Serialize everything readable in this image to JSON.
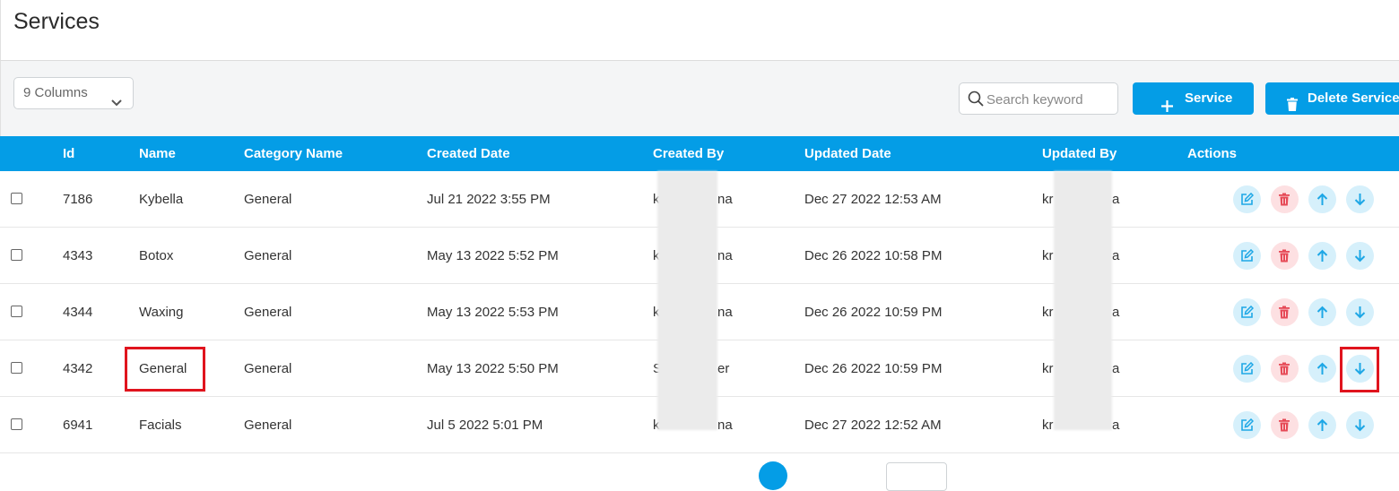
{
  "header": {
    "title": "Services"
  },
  "toolbar": {
    "columns_label": "9 Columns",
    "search_placeholder": "Search keyword",
    "add_label": "Service",
    "delete_label": "Delete Service"
  },
  "table": {
    "columns": [
      "Id",
      "Name",
      "Category Name",
      "Created Date",
      "Created By",
      "Updated Date",
      "Updated By",
      "Actions"
    ],
    "rows": [
      {
        "id": "7186",
        "name": "Kybella",
        "category": "General",
        "created_date": "Jul 21 2022 3:55 PM",
        "created_by_start": "k",
        "created_by_end": "na",
        "updated_date": "Dec 27 2022 12:53 AM",
        "updated_by_start": "kr",
        "updated_by_end": "a"
      },
      {
        "id": "4343",
        "name": "Botox",
        "category": "General",
        "created_date": "May 13 2022 5:52 PM",
        "created_by_start": "k",
        "created_by_end": "na",
        "updated_date": "Dec 26 2022 10:58 PM",
        "updated_by_start": "kr",
        "updated_by_end": "a"
      },
      {
        "id": "4344",
        "name": "Waxing",
        "category": "General",
        "created_date": "May 13 2022 5:53 PM",
        "created_by_start": "k",
        "created_by_end": "na",
        "updated_date": "Dec 26 2022 10:59 PM",
        "updated_by_start": "kr",
        "updated_by_end": "a"
      },
      {
        "id": "4342",
        "name": "General",
        "category": "General",
        "created_date": "May 13 2022 5:50 PM",
        "created_by_start": "S",
        "created_by_end": "er",
        "updated_date": "Dec 26 2022 10:59 PM",
        "updated_by_start": "kr",
        "updated_by_end": "a"
      },
      {
        "id": "6941",
        "name": "Facials",
        "category": "General",
        "created_date": "Jul 5 2022 5:01 PM",
        "created_by_start": "k",
        "created_by_end": "na",
        "updated_date": "Dec 27 2022 12:52 AM",
        "updated_by_start": "kr",
        "updated_by_end": "a"
      }
    ]
  },
  "icons": {
    "edit": "edit-icon",
    "delete": "trash-icon",
    "up": "arrow-up-icon",
    "down": "arrow-down-icon"
  },
  "colors": {
    "primary": "#049de6",
    "highlight": "#e0141e",
    "delete_action": "#e64a57"
  }
}
